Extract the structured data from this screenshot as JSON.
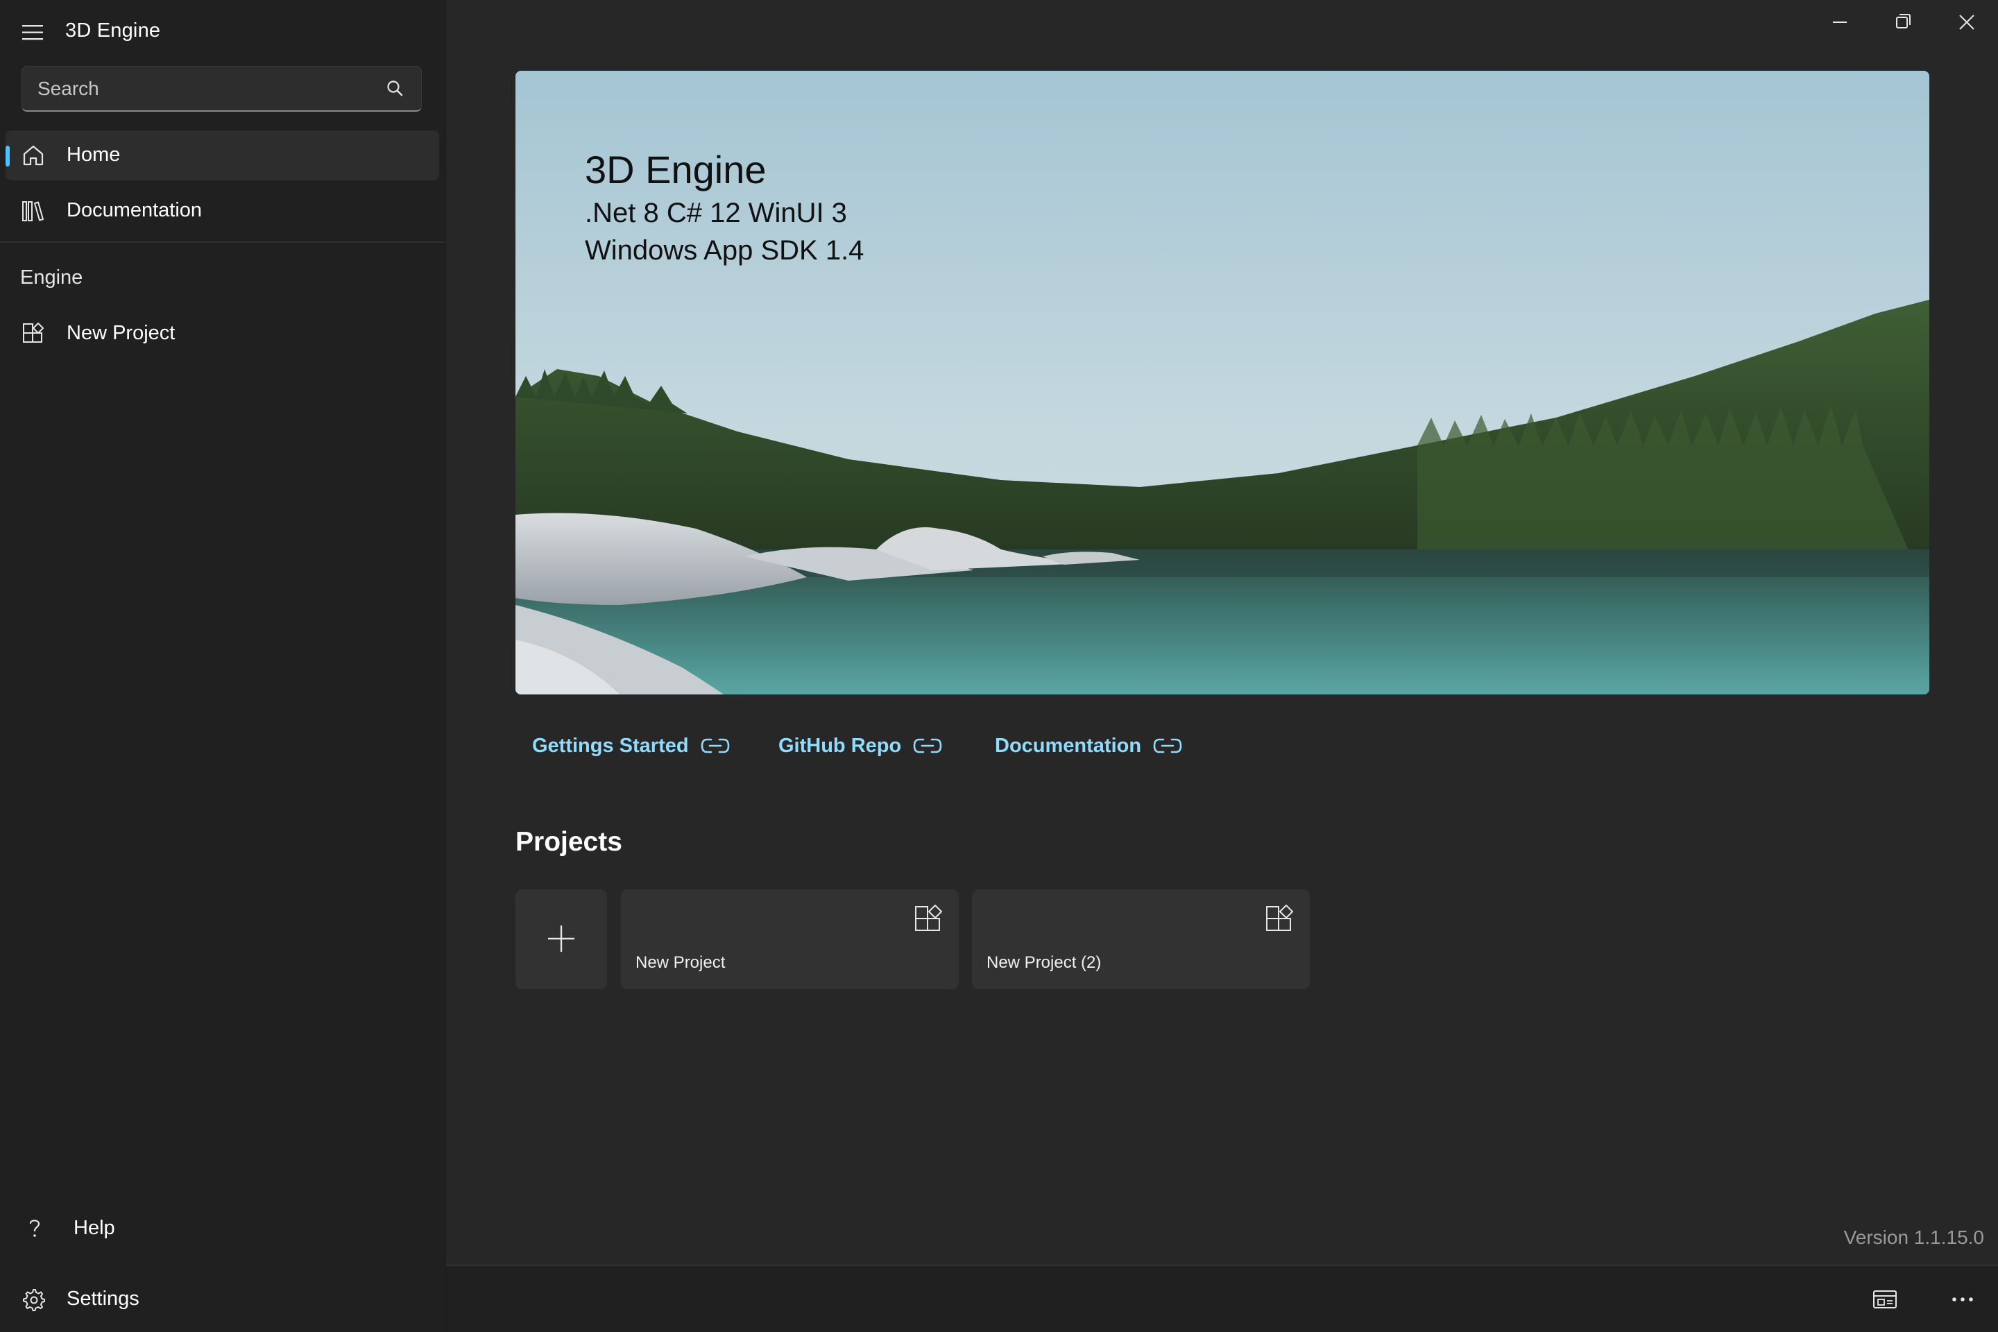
{
  "app": {
    "title": "3D Engine"
  },
  "search": {
    "placeholder": "Search"
  },
  "nav": {
    "items": [
      {
        "label": "Home",
        "icon": "home-icon",
        "selected": true
      },
      {
        "label": "Documentation",
        "icon": "library-icon",
        "selected": false
      }
    ],
    "section_header": "Engine",
    "section_items": [
      {
        "label": "New Project",
        "icon": "app-add-icon"
      }
    ],
    "footer_items": [
      {
        "label": "Help",
        "icon": "question-icon"
      },
      {
        "label": "Settings",
        "icon": "gear-icon"
      }
    ]
  },
  "window_controls": {
    "minimize": "minimize-icon",
    "restore": "restore-icon",
    "close": "close-icon"
  },
  "hero": {
    "title": "3D Engine",
    "line1": ".Net 8  C# 12  WinUI 3",
    "line2": "Windows App SDK 1.4"
  },
  "links": [
    {
      "label": "Gettings Started",
      "icon": "link-icon"
    },
    {
      "label": "GitHub Repo",
      "icon": "link-icon"
    },
    {
      "label": "Documentation",
      "icon": "link-icon"
    }
  ],
  "projects": {
    "title": "Projects",
    "add_icon": "plus-icon",
    "items": [
      {
        "label": "New Project",
        "icon": "app-add-icon"
      },
      {
        "label": "New Project (2)",
        "icon": "app-add-icon"
      }
    ]
  },
  "status": {
    "version": "Version 1.1.15.0"
  },
  "bottom_bar": {
    "icons": [
      "status-panel-icon",
      "more-icon"
    ]
  },
  "colors": {
    "accent": "#4cc2ff",
    "link": "#8fdcff",
    "sidebar_bg": "#202020",
    "main_bg": "#272727",
    "card_bg": "#323232"
  }
}
